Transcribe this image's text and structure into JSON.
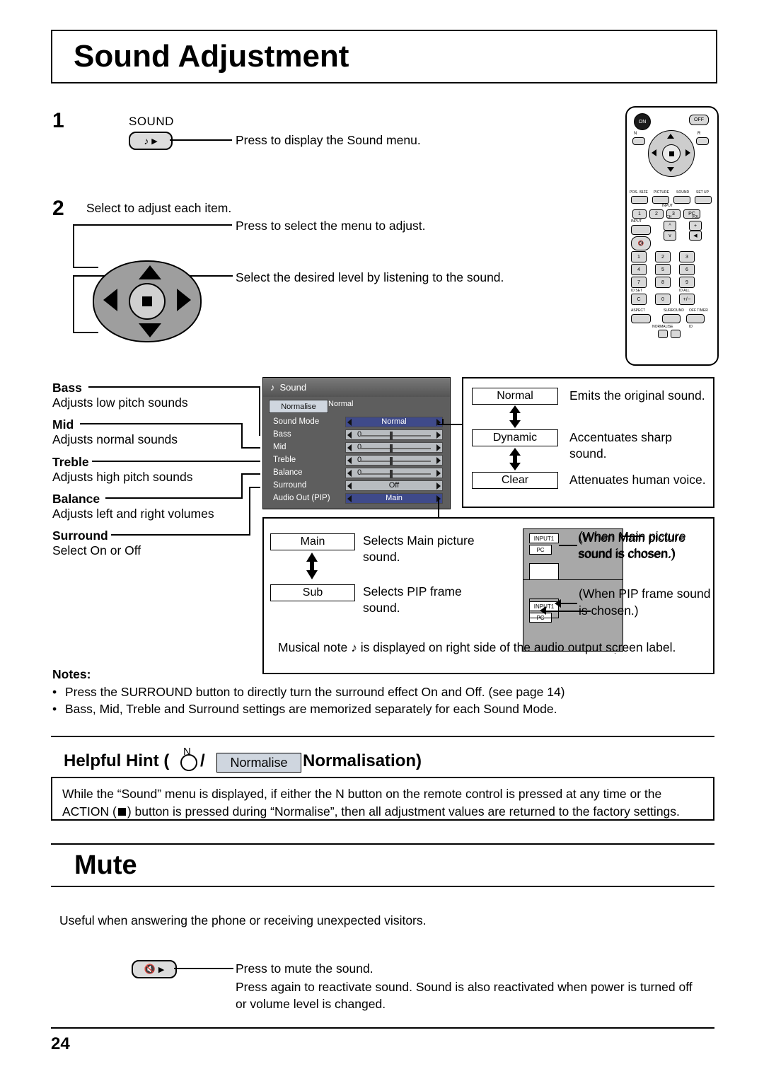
{
  "page": {
    "title": "Sound Adjustment",
    "number": "24"
  },
  "steps": [
    {
      "num": "1",
      "button_label": "SOUND",
      "icon": "music-note-icon",
      "text": "Press to display the Sound menu."
    },
    {
      "num": "2",
      "text": "Select to adjust each item."
    }
  ],
  "pad_texts": {
    "up_down": "Press to select the menu to adjust.",
    "left_right": "Select the desired level by listening to the sound."
  },
  "items": [
    {
      "name": "Bass",
      "desc": "Adjusts low pitch sounds"
    },
    {
      "name": "Mid",
      "desc": "Adjusts normal sounds"
    },
    {
      "name": "Treble",
      "desc": "Adjusts high pitch sounds"
    },
    {
      "name": "Balance",
      "desc": "Adjusts left and right volumes"
    },
    {
      "name": "Surround",
      "desc": "Select On or Off"
    }
  ],
  "osd": {
    "title": "Sound",
    "note_icon": "music-note-icon",
    "normalise_button": "Normalise",
    "normal_label": "Normal",
    "rows": [
      {
        "label": "Sound Mode",
        "value": "Normal",
        "type": "select"
      },
      {
        "label": "Bass",
        "value": "0",
        "type": "slider"
      },
      {
        "label": "Mid",
        "value": "0",
        "type": "slider"
      },
      {
        "label": "Treble",
        "value": "0",
        "type": "slider"
      },
      {
        "label": "Balance",
        "value": "0",
        "type": "slider"
      },
      {
        "label": "Surround",
        "value": "Off",
        "type": "select"
      },
      {
        "label": "Audio Out (PIP)",
        "value": "Main",
        "type": "select"
      }
    ]
  },
  "sound_modes": [
    {
      "label": "Normal",
      "desc": "Emits the original sound."
    },
    {
      "label": "Dynamic",
      "desc": "Accentuates sharp sound."
    },
    {
      "label": "Clear",
      "desc": "Attenuates human voice."
    }
  ],
  "audio_out": [
    {
      "label": "Main",
      "desc": "Selects Main picture sound.",
      "note": "(When Main picture sound is chosen.)",
      "tag1": "INPUT1",
      "tag2": "PC"
    },
    {
      "label": "Sub",
      "desc": "Selects PIP frame sound.",
      "note": "(When PIP frame sound is chosen.)",
      "tag1": "INPUT1",
      "tag2": "PC"
    }
  ],
  "musical_note_text": "Musical note    is displayed on right side of the audio output screen label.",
  "notes": {
    "heading": "Notes:",
    "items": [
      "Press the SURROUND button to directly turn the surround effect On and Off. (see page 14)",
      "Bass, Mid, Treble and Surround settings are memorized separately for each Sound Mode."
    ]
  },
  "hint": {
    "prefix": "Helpful Hint (",
    "n_label": "N",
    "slash": "/",
    "normalise": "Normalise",
    "suffix": " Normalisation)",
    "body_line1": "While the “Sound” menu is displayed, if either the N button on the remote control is pressed at any time or the",
    "body_line2_a": "ACTION (",
    "body_line2_b": ") button is pressed during “Normalise”, then all adjustment values are returned to the factory settings."
  },
  "mute": {
    "heading": "Mute",
    "intro": "Useful when answering the phone or receiving unexpected visitors.",
    "button_icon": "mute-speaker-icon",
    "line1": "Press to mute the sound.",
    "line2": "Press again to reactivate sound. Sound is also reactivated when power is turned off",
    "line3": "or volume level is changed."
  },
  "remote": {
    "on": "ON",
    "off": "OFF",
    "n": "N",
    "r": "R",
    "row_labels": [
      "POS. /SIZE",
      "PICTURE",
      "SOUND",
      "SET UP"
    ],
    "input_label": "INPUT",
    "ch_label": "CH",
    "vol_label": "VOL",
    "numbers": [
      "1",
      "2",
      "3",
      "PC",
      "1",
      "2",
      "3",
      "4",
      "5",
      "6",
      "7",
      "8",
      "9",
      "C",
      "0",
      "+/--"
    ],
    "id_set": "ID SET",
    "id_all": "ID ALL",
    "aspect": "ASPECT",
    "surround": "SURROUND",
    "off_timer": "OFF TIMER",
    "normalise": "NORMALISE",
    "id": "ID"
  }
}
